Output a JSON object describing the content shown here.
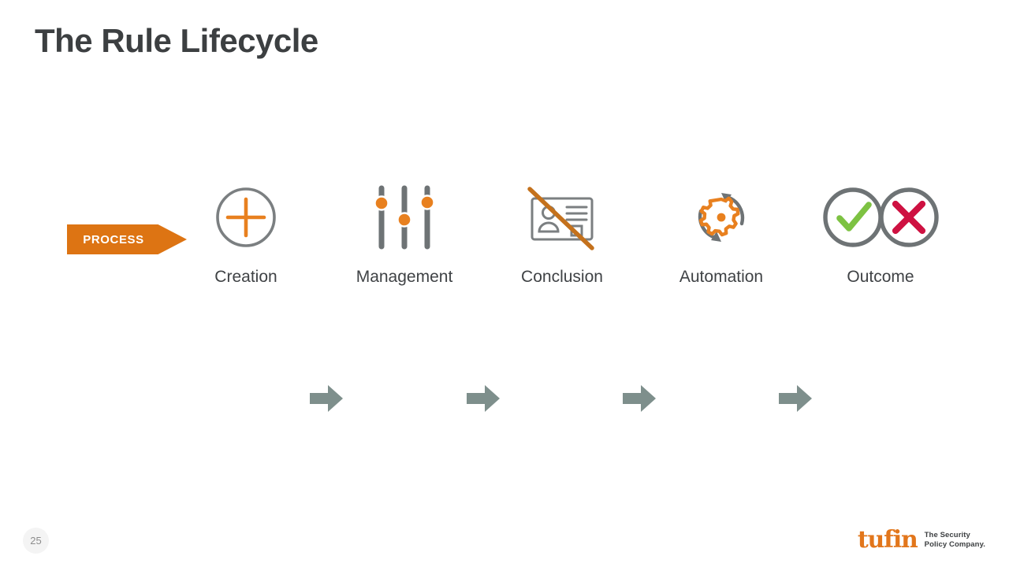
{
  "slide": {
    "title": "The Rule Lifecycle",
    "page_number": "25"
  },
  "process_badge": {
    "label": "PROCESS",
    "color": "#DD7413",
    "text_color": "#FFFFFF"
  },
  "stages": [
    {
      "label": "Creation",
      "icon": "plus-in-circle-icon",
      "accent": "#E8801F",
      "outline": "#7B7F81"
    },
    {
      "label": "Management",
      "icon": "sliders-icon",
      "accent": "#E8801F",
      "outline": "#6E7375"
    },
    {
      "label": "Conclusion",
      "icon": "id-card-crossed-out-icon",
      "accent": "#C4711C",
      "outline": "#7B7F81"
    },
    {
      "label": "Automation",
      "icon": "refresh-gear-icon",
      "accent": "#E8801F",
      "outline": "#6E7375"
    },
    {
      "label": "Outcome",
      "icon": "check-and-cross-circles-icon",
      "accent": "#7DC242",
      "accent_secondary": "#CE1141",
      "outline": "#6E7375"
    }
  ],
  "connectors": [
    {
      "icon": "arrow-right-icon",
      "color": "#7E8F8C"
    },
    {
      "icon": "arrow-right-icon",
      "color": "#7E8F8C"
    },
    {
      "icon": "arrow-right-icon",
      "color": "#7E8F8C"
    },
    {
      "icon": "arrow-right-icon",
      "color": "#7E8F8C"
    }
  ],
  "brand": {
    "wordmark": "tufin",
    "tagline_line1": "The Security",
    "tagline_line2": "Policy Company.",
    "color": "#E2761B"
  }
}
